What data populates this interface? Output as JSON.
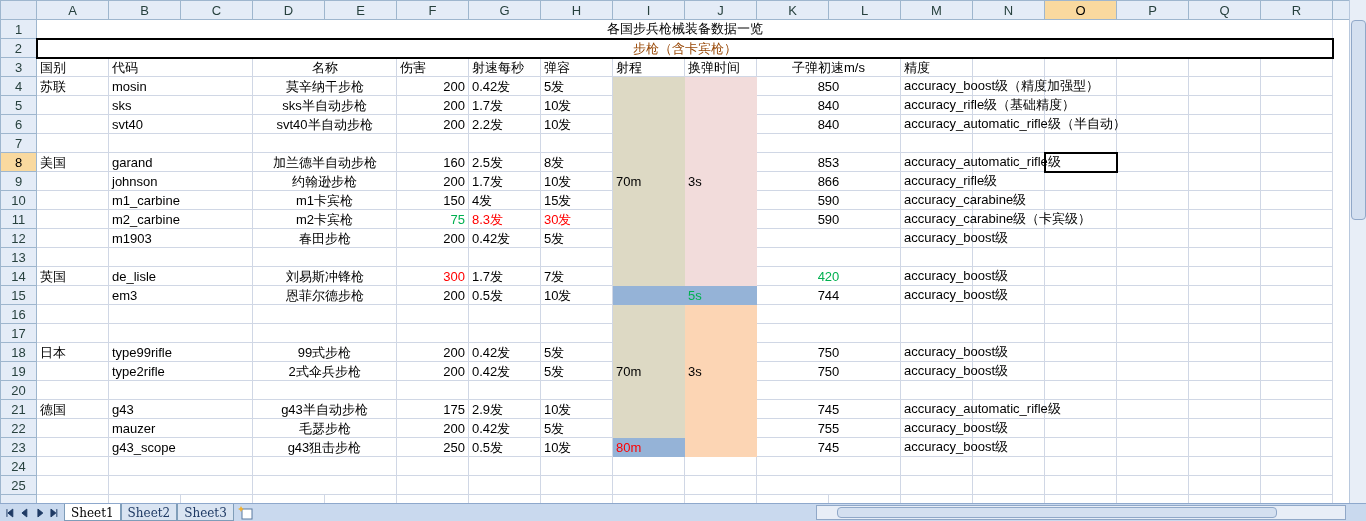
{
  "columns": [
    {
      "label": "A",
      "selected": false
    },
    {
      "label": "B",
      "selected": false
    },
    {
      "label": "C",
      "selected": false
    },
    {
      "label": "D",
      "selected": false
    },
    {
      "label": "E",
      "selected": false
    },
    {
      "label": "F",
      "selected": false
    },
    {
      "label": "G",
      "selected": false
    },
    {
      "label": "H",
      "selected": false
    },
    {
      "label": "I",
      "selected": false
    },
    {
      "label": "J",
      "selected": false
    },
    {
      "label": "K",
      "selected": false
    },
    {
      "label": "L",
      "selected": false
    },
    {
      "label": "M",
      "selected": false
    },
    {
      "label": "N",
      "selected": false
    },
    {
      "label": "O",
      "selected": true
    },
    {
      "label": "P",
      "selected": false
    },
    {
      "label": "Q",
      "selected": false
    },
    {
      "label": "R",
      "selected": false
    }
  ],
  "rows": [
    {
      "number": "1",
      "selected": false,
      "kind": "title",
      "text": "各国步兵枪械装备数据一览"
    },
    {
      "number": "2",
      "selected": false,
      "kind": "subtitle",
      "text": "步枪（含卡宾枪）",
      "color": "#984807"
    },
    {
      "number": "3",
      "selected": false,
      "kind": "header",
      "country": "国别",
      "code": "代码",
      "name": "名称",
      "damage": "伤害",
      "rate": "射速每秒",
      "mag": "弹容",
      "range": "射程",
      "reload": "换弹时间",
      "velocity": "子弹初速m/s",
      "accuracy": "精度"
    },
    {
      "number": "4",
      "selected": false,
      "kind": "data",
      "country": "苏联",
      "code": "mosin",
      "name": "莫辛纳干步枪",
      "damage": "200",
      "rate": "0.42发",
      "mag": "5发",
      "velocity": "850",
      "accuracy": "accuracy_boost级（精度加强型）",
      "range_cell": {
        "color": "#ddd9c4"
      },
      "reload_cell": {
        "color": "#f2dcdb"
      }
    },
    {
      "number": "5",
      "selected": false,
      "kind": "data",
      "code": "sks",
      "name": "sks半自动步枪",
      "damage": "200",
      "rate": "1.7发",
      "mag": "10发",
      "velocity": "840",
      "accuracy": "accuracy_rifle级（基础精度）",
      "range_cell": {
        "color": "#ddd9c4"
      },
      "reload_cell": {
        "color": "#f2dcdb"
      }
    },
    {
      "number": "6",
      "selected": false,
      "kind": "data",
      "code": "svt40",
      "name": "svt40半自动步枪",
      "damage": "200",
      "rate": "2.2发",
      "mag": "10发",
      "velocity": "840",
      "accuracy": "accuracy_automatic_rifle级（半自动）",
      "range_cell": {
        "color": "#ddd9c4"
      },
      "reload_cell": {
        "color": "#f2dcdb"
      }
    },
    {
      "number": "7",
      "selected": false,
      "kind": "blank",
      "range_cell": {
        "color": "#ddd9c4"
      },
      "reload_cell": {
        "color": "#f2dcdb"
      }
    },
    {
      "number": "8",
      "selected": true,
      "kind": "data",
      "country": "美国",
      "code": "garand",
      "name": "加兰德半自动步枪",
      "damage": "160",
      "rate": "2.5发",
      "mag": "8发",
      "velocity": "853",
      "accuracy": "accuracy_automatic_rifle级",
      "range_cell": {
        "color": "#ddd9c4"
      },
      "reload_cell": {
        "color": "#f2dcdb"
      }
    },
    {
      "number": "9",
      "selected": false,
      "kind": "data",
      "code": "johnson",
      "name": "约翰逊步枪",
      "damage": "200",
      "rate": "1.7发",
      "mag": "10发",
      "velocity": "866",
      "accuracy": "accuracy_rifle级",
      "range_cell": {
        "label": "70m",
        "color": "#ddd9c4"
      },
      "reload_cell": {
        "label": "3s",
        "color": "#f2dcdb"
      }
    },
    {
      "number": "10",
      "selected": false,
      "kind": "data",
      "code": "m1_carbine",
      "name": "m1卡宾枪",
      "damage": "150",
      "rate": "4发",
      "mag": "15发",
      "velocity": "590",
      "accuracy": "accuracy_carabine级",
      "range_cell": {
        "color": "#ddd9c4"
      },
      "reload_cell": {
        "color": "#f2dcdb"
      }
    },
    {
      "number": "11",
      "selected": false,
      "kind": "data",
      "code": "m2_carbine",
      "name": "m2卡宾枪",
      "damage": {
        "text": "75",
        "color": "#00b050"
      },
      "rate": {
        "text": "8.3发",
        "color": "#ff0000"
      },
      "mag": {
        "text": "30发",
        "color": "#ff0000"
      },
      "velocity": "590",
      "accuracy": "accuracy_carabine级（卡宾级）",
      "range_cell": {
        "color": "#ddd9c4"
      },
      "reload_cell": {
        "color": "#f2dcdb"
      }
    },
    {
      "number": "12",
      "selected": false,
      "kind": "data",
      "code": "m1903",
      "name": "春田步枪",
      "damage": "200",
      "rate": "0.42发",
      "mag": "5发",
      "accuracy": "accuracy_boost级",
      "range_cell": {
        "color": "#ddd9c4"
      },
      "reload_cell": {
        "color": "#f2dcdb"
      }
    },
    {
      "number": "13",
      "selected": false,
      "kind": "blank",
      "range_cell": {
        "color": "#ddd9c4"
      },
      "reload_cell": {
        "color": "#f2dcdb"
      }
    },
    {
      "number": "14",
      "selected": false,
      "kind": "data",
      "country": "英国",
      "code": "de_lisle",
      "name": "刘易斯冲锋枪",
      "damage": {
        "text": "300",
        "color": "#ff0000"
      },
      "rate": "1.7发",
      "mag": "7发",
      "velocity": {
        "text": "420",
        "color": "#00b050"
      },
      "accuracy": "accuracy_boost级",
      "range_cell": {
        "color": "#ddd9c4"
      },
      "reload_cell": {
        "color": "#f2dcdb"
      }
    },
    {
      "number": "15",
      "selected": false,
      "kind": "data",
      "code": "em3",
      "name": "恩菲尔德步枪",
      "damage": "200",
      "rate": "0.5发",
      "mag": "10发",
      "velocity": "744",
      "accuracy": "accuracy_boost级",
      "range_cell": {
        "color": "#95b3d7"
      },
      "reload_cell": {
        "label": {
          "text": "5s",
          "color": "#00b050"
        },
        "color": "#95b3d7"
      }
    },
    {
      "number": "16",
      "selected": false,
      "kind": "blank",
      "range_cell": {
        "color": "#ddd9c4"
      },
      "reload_cell": {
        "color": "#fcd5b4"
      }
    },
    {
      "number": "17",
      "selected": false,
      "kind": "blank",
      "range_cell": {
        "color": "#ddd9c4"
      },
      "reload_cell": {
        "color": "#fcd5b4"
      }
    },
    {
      "number": "18",
      "selected": false,
      "kind": "data",
      "country": "日本",
      "code": "type99rifle",
      "name": "99式步枪",
      "damage": "200",
      "rate": "0.42发",
      "mag": "5发",
      "velocity": "750",
      "accuracy": "accuracy_boost级",
      "range_cell": {
        "color": "#ddd9c4"
      },
      "reload_cell": {
        "color": "#fcd5b4"
      }
    },
    {
      "number": "19",
      "selected": false,
      "kind": "data",
      "code": "type2rifle",
      "name": "2式伞兵步枪",
      "damage": "200",
      "rate": "0.42发",
      "mag": "5发",
      "velocity": "750",
      "accuracy": "accuracy_boost级",
      "range_cell": {
        "label": "70m",
        "color": "#ddd9c4"
      },
      "reload_cell": {
        "label": "3s",
        "color": "#fcd5b4"
      }
    },
    {
      "number": "20",
      "selected": false,
      "kind": "blank",
      "range_cell": {
        "color": "#ddd9c4"
      },
      "reload_cell": {
        "color": "#fcd5b4"
      }
    },
    {
      "number": "21",
      "selected": false,
      "kind": "data",
      "country": "德国",
      "code": "g43",
      "name": "g43半自动步枪",
      "damage": "175",
      "rate": "2.9发",
      "mag": "10发",
      "velocity": "745",
      "accuracy": "accuracy_automatic_rifle级",
      "range_cell": {
        "color": "#ddd9c4"
      },
      "reload_cell": {
        "color": "#fcd5b4"
      }
    },
    {
      "number": "22",
      "selected": false,
      "kind": "data",
      "code": "mauzer",
      "name": "毛瑟步枪",
      "damage": "200",
      "rate": "0.42发",
      "mag": "5发",
      "velocity": "755",
      "accuracy": "accuracy_boost级",
      "range_cell": {
        "color": "#ddd9c4"
      },
      "reload_cell": {
        "color": "#fcd5b4"
      }
    },
    {
      "number": "23",
      "selected": false,
      "kind": "data",
      "code": "g43_scope",
      "name": "g43狙击步枪",
      "damage": "250",
      "rate": "0.5发",
      "mag": "10发",
      "velocity": "745",
      "accuracy": "accuracy_boost级",
      "range_cell": {
        "label": {
          "text": "80m",
          "color": "#ff0000"
        },
        "color": "#95b3d7"
      },
      "reload_cell": {
        "color": "#fcd5b4"
      }
    },
    {
      "number": "24",
      "selected": false,
      "kind": "blank"
    },
    {
      "number": "25",
      "selected": false,
      "kind": "blank"
    }
  ],
  "sheet_tabs": [
    {
      "label": "Sheet1",
      "selected": true
    },
    {
      "label": "Sheet2",
      "selected": false
    },
    {
      "label": "Sheet3",
      "selected": false
    }
  ]
}
